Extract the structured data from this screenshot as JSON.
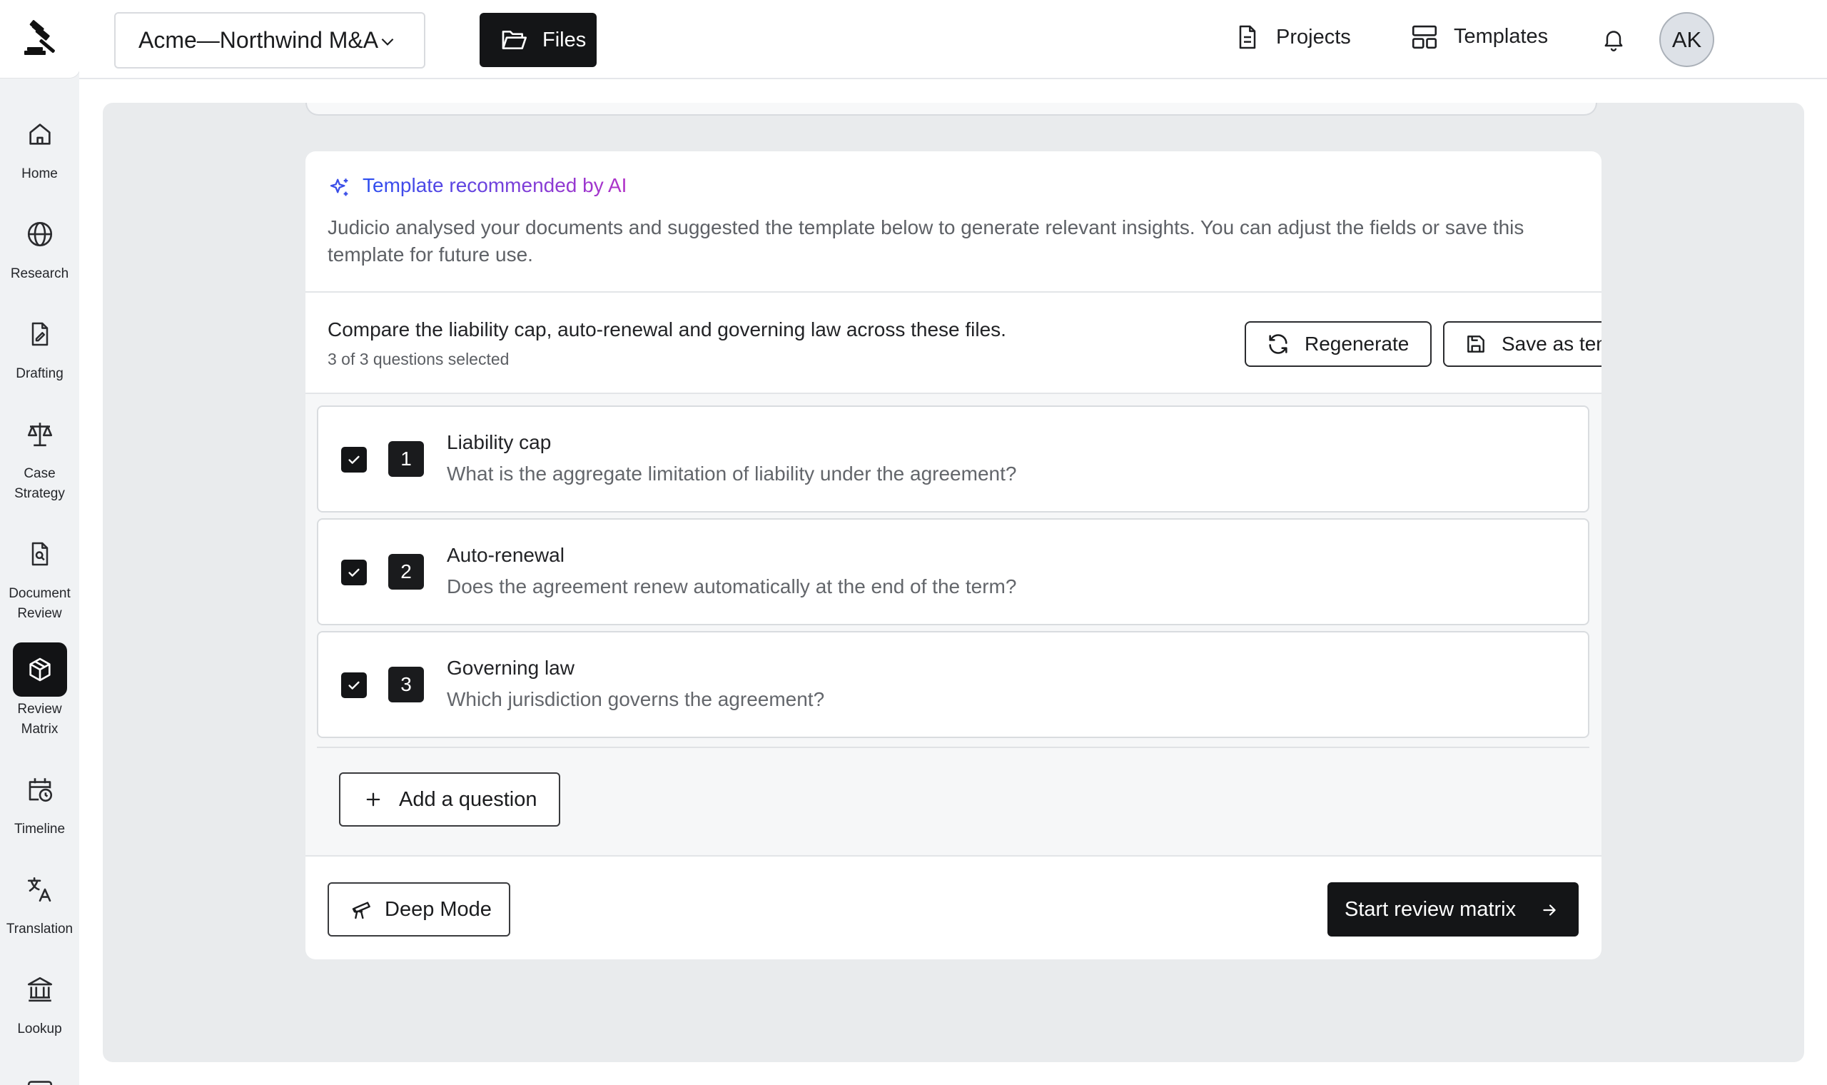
{
  "sidebar": {
    "logo": "gavel-logo",
    "items": [
      {
        "label": "Home",
        "icon": "home-icon"
      },
      {
        "label": "Research",
        "icon": "globe-icon"
      },
      {
        "label": "Drafting",
        "icon": "document-pen-icon"
      },
      {
        "label": "Case\nStrategy",
        "icon": "scales-icon"
      },
      {
        "label": "Document\nReview",
        "icon": "document-search-icon"
      },
      {
        "label": "Review\nMatrix",
        "icon": "cube-icon",
        "active": true
      },
      {
        "label": "Timeline",
        "icon": "calendar-clock-icon"
      },
      {
        "label": "Translation",
        "icon": "translate-icon"
      },
      {
        "label": "Lookup",
        "icon": "institution-icon"
      }
    ]
  },
  "header": {
    "project": "Acme—Northwind M&A",
    "files_label": "Files",
    "projects_label": "Projects",
    "templates_label": "Templates",
    "avatar_initials": "AK"
  },
  "card": {
    "ai_title": "Template recommended by AI",
    "ai_description": "Judicio analysed your documents and suggested the template below to generate relevant insights. You can adjust the fields or save this template for future use.",
    "prompt": "Compare the liability cap, auto-renewal and governing law across these files.",
    "selected_count": "3 of 3 questions selected",
    "regenerate_label": "Regenerate",
    "save_template_label": "Save as template",
    "questions": [
      {
        "number": "1",
        "title": "Liability cap",
        "description": "What is the aggregate limitation of liability under the agreement?",
        "checked": true
      },
      {
        "number": "2",
        "title": "Auto-renewal",
        "description": "Does the agreement renew automatically at the end of the term?",
        "checked": true
      },
      {
        "number": "3",
        "title": "Governing law",
        "description": "Which jurisdiction governs the agreement?",
        "checked": true
      }
    ],
    "add_question_label": "Add a question",
    "deep_mode_label": "Deep Mode",
    "start_label": "Start review matrix"
  },
  "colors": {
    "accent_dark": "#141517",
    "ai_gradient_start": "#2c4ff0",
    "ai_gradient_end": "#b132c8",
    "main_bg": "#e9ebed"
  }
}
